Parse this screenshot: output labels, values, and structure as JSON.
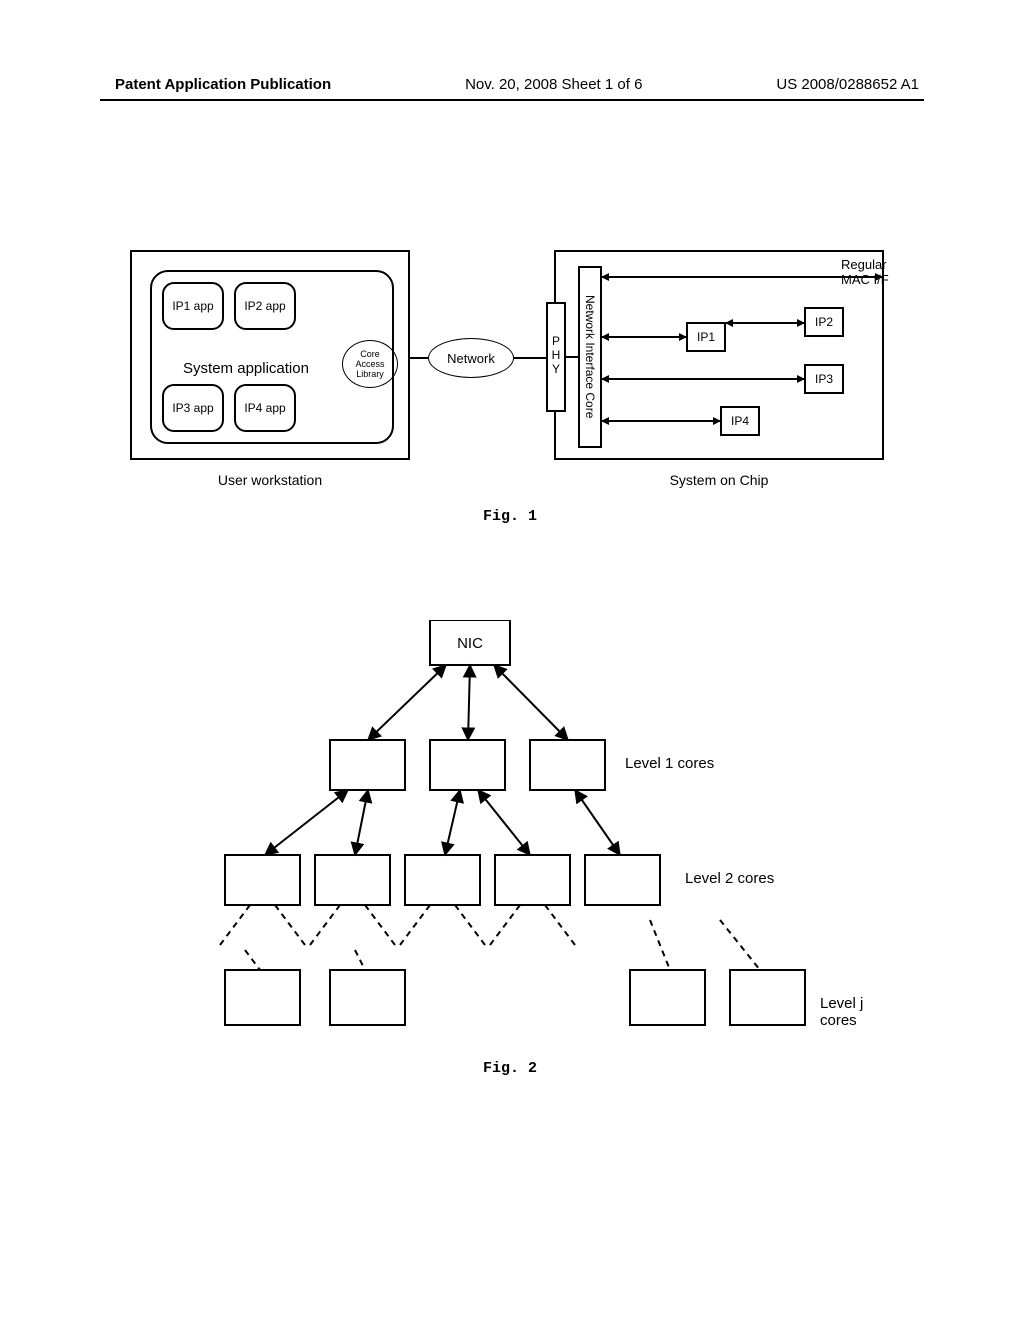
{
  "header": {
    "pubtype": "Patent Application Publication",
    "date_sheet": "Nov. 20, 2008  Sheet 1 of 6",
    "pubnum": "US 2008/0288652 A1"
  },
  "fig1": {
    "caption": "Fig. 1",
    "workstation": {
      "label": "User workstation",
      "sys_app": "System application",
      "ip1": "IP1 app",
      "ip2": "IP2 app",
      "ip3": "IP3 app",
      "ip4": "IP4 app",
      "cal": "Core\nAccess\nLibrary"
    },
    "network": "Network",
    "soc": {
      "label": "System on Chip",
      "phy": "P\nH\nY",
      "nic": "Network Interface Core",
      "mac": "Regular\nMAC I/F",
      "ip1": "IP1",
      "ip2": "IP2",
      "ip3": "IP3",
      "ip4": "IP4"
    }
  },
  "fig2": {
    "caption": "Fig. 2",
    "root": "NIC",
    "level1_label": "Level 1 cores",
    "level2_label": "Level 2 cores",
    "levelj_label": "Level j cores"
  }
}
